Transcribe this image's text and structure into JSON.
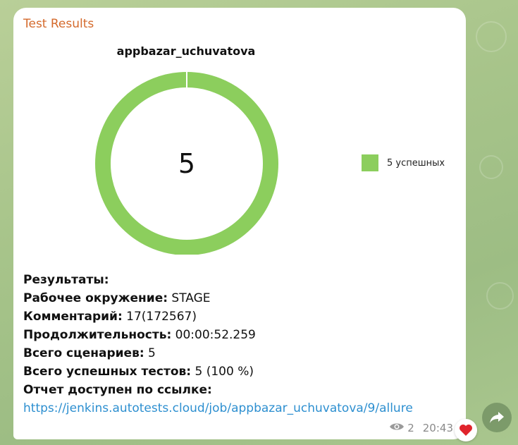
{
  "message": {
    "sender": "Test Results",
    "chart_data": {
      "type": "pie",
      "title": "appbazar_uchuvatova",
      "center_label": "5",
      "slices": [
        {
          "name": "5 успешных",
          "value": 5,
          "color": "#8cce5d"
        }
      ],
      "legend_position": "right"
    },
    "info": {
      "results_label": "Результаты:",
      "env_key": "Рабочее окружение:",
      "env_value": " STAGE",
      "comment_key": "Комментарий:",
      "comment_value": " 17(172567)",
      "duration_key": "Продолжительность:",
      "duration_value": " 00:00:52.259",
      "scenarios_key": "Всего сценариев:",
      "scenarios_value": " 5",
      "passed_key": "Всего успешных тестов:",
      "passed_value": " 5 (100 %)",
      "report_key": "Отчет доступен по ссылке:",
      "report_link": "https://jenkins.autotests.cloud/job/appbazar_uchuvatova/9/allure"
    },
    "meta": {
      "views": "2",
      "time": "20:43"
    }
  },
  "icons": {
    "views": "eye-icon",
    "reaction": "heart-icon",
    "share": "share-arrow-icon"
  }
}
